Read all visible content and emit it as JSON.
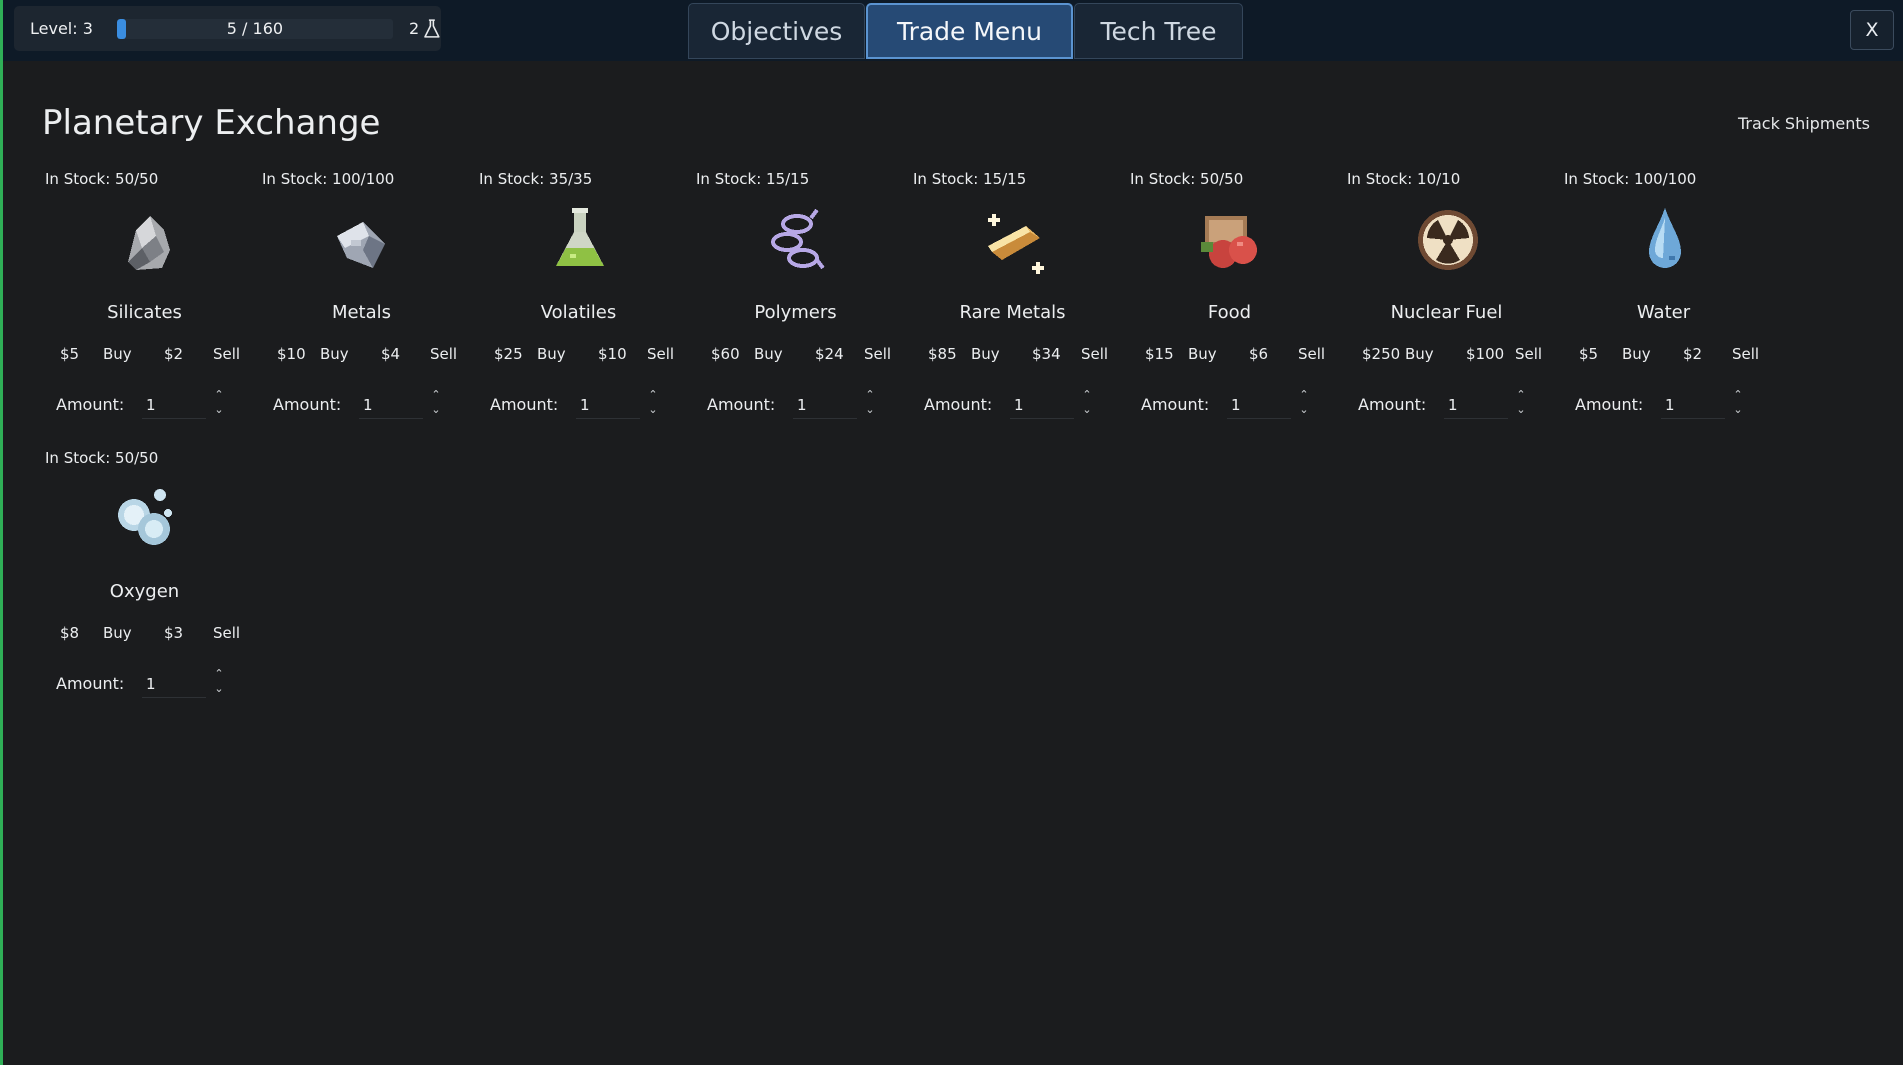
{
  "top_bar": {
    "level_label": "Level: 3",
    "xp_text": "5 / 160",
    "xp_progress": 0.03125,
    "research_points": "2",
    "research_icon": "flask-icon",
    "close_label": "X"
  },
  "tabs": [
    {
      "label": "Objectives",
      "active": false
    },
    {
      "label": "Trade Menu",
      "active": true
    },
    {
      "label": "Tech Tree",
      "active": false
    }
  ],
  "page": {
    "title": "Planetary Exchange",
    "track_shipments": "Track Shipments",
    "buy_label": "Buy",
    "sell_label": "Sell",
    "amount_label": "Amount:"
  },
  "resources": [
    {
      "name": "Silicates",
      "stock": "In Stock: 50/50",
      "buy_price": "$5",
      "sell_price": "$2",
      "amount": "1",
      "icon": "silicates-icon"
    },
    {
      "name": "Metals",
      "stock": "In Stock: 100/100",
      "buy_price": "$10",
      "sell_price": "$4",
      "amount": "1",
      "icon": "metals-icon"
    },
    {
      "name": "Volatiles",
      "stock": "In Stock: 35/35",
      "buy_price": "$25",
      "sell_price": "$10",
      "amount": "1",
      "icon": "volatiles-flask-icon"
    },
    {
      "name": "Polymers",
      "stock": "In Stock: 15/15",
      "buy_price": "$60",
      "sell_price": "$24",
      "amount": "1",
      "icon": "polymers-molecule-icon"
    },
    {
      "name": "Rare Metals",
      "stock": "In Stock: 15/15",
      "buy_price": "$85",
      "sell_price": "$34",
      "amount": "1",
      "icon": "rare-metals-ingot-icon"
    },
    {
      "name": "Food",
      "stock": "In Stock: 50/50",
      "buy_price": "$15",
      "sell_price": "$6",
      "amount": "1",
      "icon": "food-icon"
    },
    {
      "name": "Nuclear Fuel",
      "stock": "In Stock: 10/10",
      "buy_price": "$250",
      "sell_price": "$100",
      "amount": "1",
      "icon": "nuclear-fuel-icon"
    },
    {
      "name": "Water",
      "stock": "In Stock: 100/100",
      "buy_price": "$5",
      "sell_price": "$2",
      "amount": "1",
      "icon": "water-drop-icon"
    },
    {
      "name": "Oxygen",
      "stock": "In Stock: 50/50",
      "buy_price": "$8",
      "sell_price": "$3",
      "amount": "1",
      "icon": "oxygen-bubbles-icon"
    }
  ]
}
